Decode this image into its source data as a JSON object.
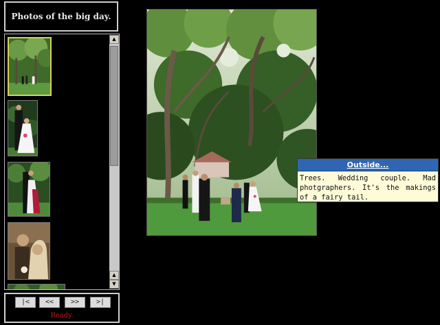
{
  "header": {
    "title": "Photos of the big day."
  },
  "gallery": {
    "thumbnails": [
      {
        "subject": "trees-ceremony",
        "selected": true
      },
      {
        "subject": "couple-portrait",
        "selected": false
      },
      {
        "subject": "couple-garden",
        "selected": false
      },
      {
        "subject": "sepia-portrait",
        "selected": false
      },
      {
        "subject": "garden-partial",
        "selected": false
      }
    ],
    "scrollbar": {
      "up_icon": "arrow-up-icon",
      "down_icon": "arrow-down-icon",
      "down2_icon": "arrow-down-icon"
    }
  },
  "nav": {
    "first_label": "|<",
    "prev_label": "<<",
    "next_label": ">>",
    "last_label": ">|",
    "status": "Ready."
  },
  "caption": {
    "title": "Outside...",
    "text": "Trees. Wedding couple. Mad photgraphers. It's the makings of a fairy tail."
  },
  "colors": {
    "background": "#000000",
    "caption_header": "#2f66b4",
    "caption_body": "#fdfbd8",
    "status_text": "#c01818",
    "selected_border": "#d8d25a"
  }
}
